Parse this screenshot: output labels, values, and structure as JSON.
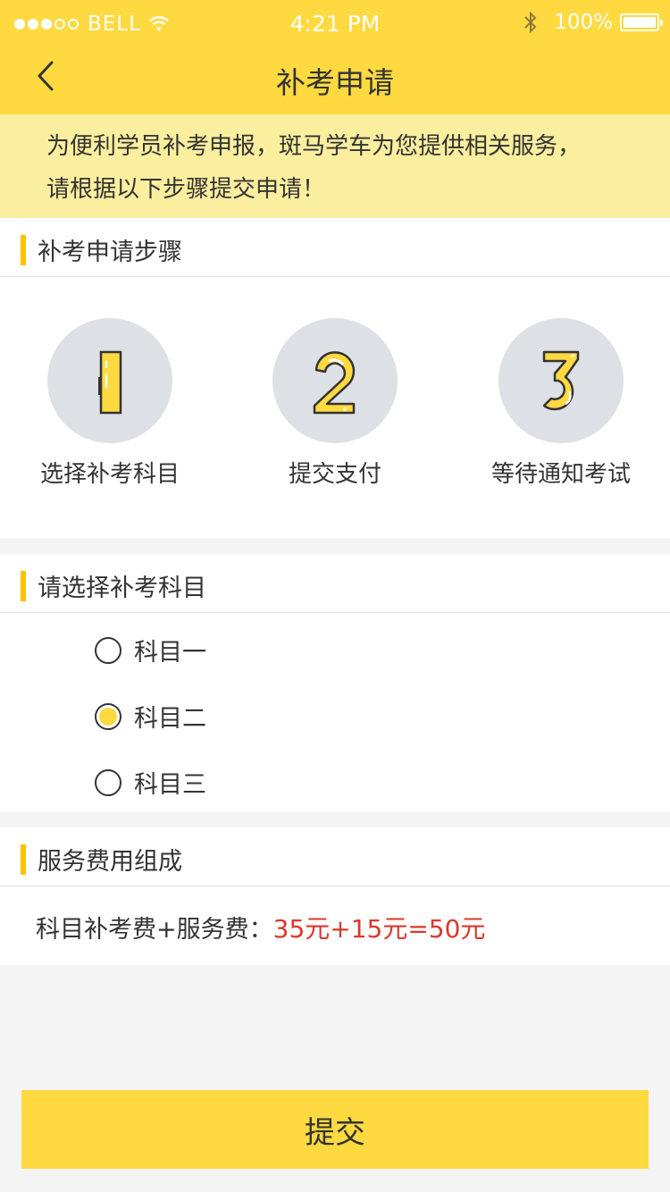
{
  "status_bar": {
    "carrier": "BELL",
    "time": "4:21 PM",
    "battery": "100%"
  },
  "nav": {
    "title": "补考申请"
  },
  "notice": {
    "line1": "为便利学员补考申报，斑马学车为您提供相关服务，",
    "line2": "请根据以下步骤提交申请！"
  },
  "steps_section": {
    "title": "补考申请步骤",
    "steps": [
      {
        "number": "1",
        "label": "选择补考科目"
      },
      {
        "number": "2",
        "label": "提交支付"
      },
      {
        "number": "3",
        "label": "等待通知考试"
      }
    ]
  },
  "subject_section": {
    "title": "请选择补考科目",
    "options": [
      {
        "label": "科目一",
        "selected": false
      },
      {
        "label": "科目二",
        "selected": true
      },
      {
        "label": "科目三",
        "selected": false
      }
    ]
  },
  "fee_section": {
    "title": "服务费用组成",
    "label": "科目补考费+服务费：",
    "value": "35元+15元=50元"
  },
  "submit": {
    "label": "提交"
  },
  "colors": {
    "accent": "#ffd940",
    "notice_bg": "#fbee9e",
    "price": "#d9392b"
  }
}
